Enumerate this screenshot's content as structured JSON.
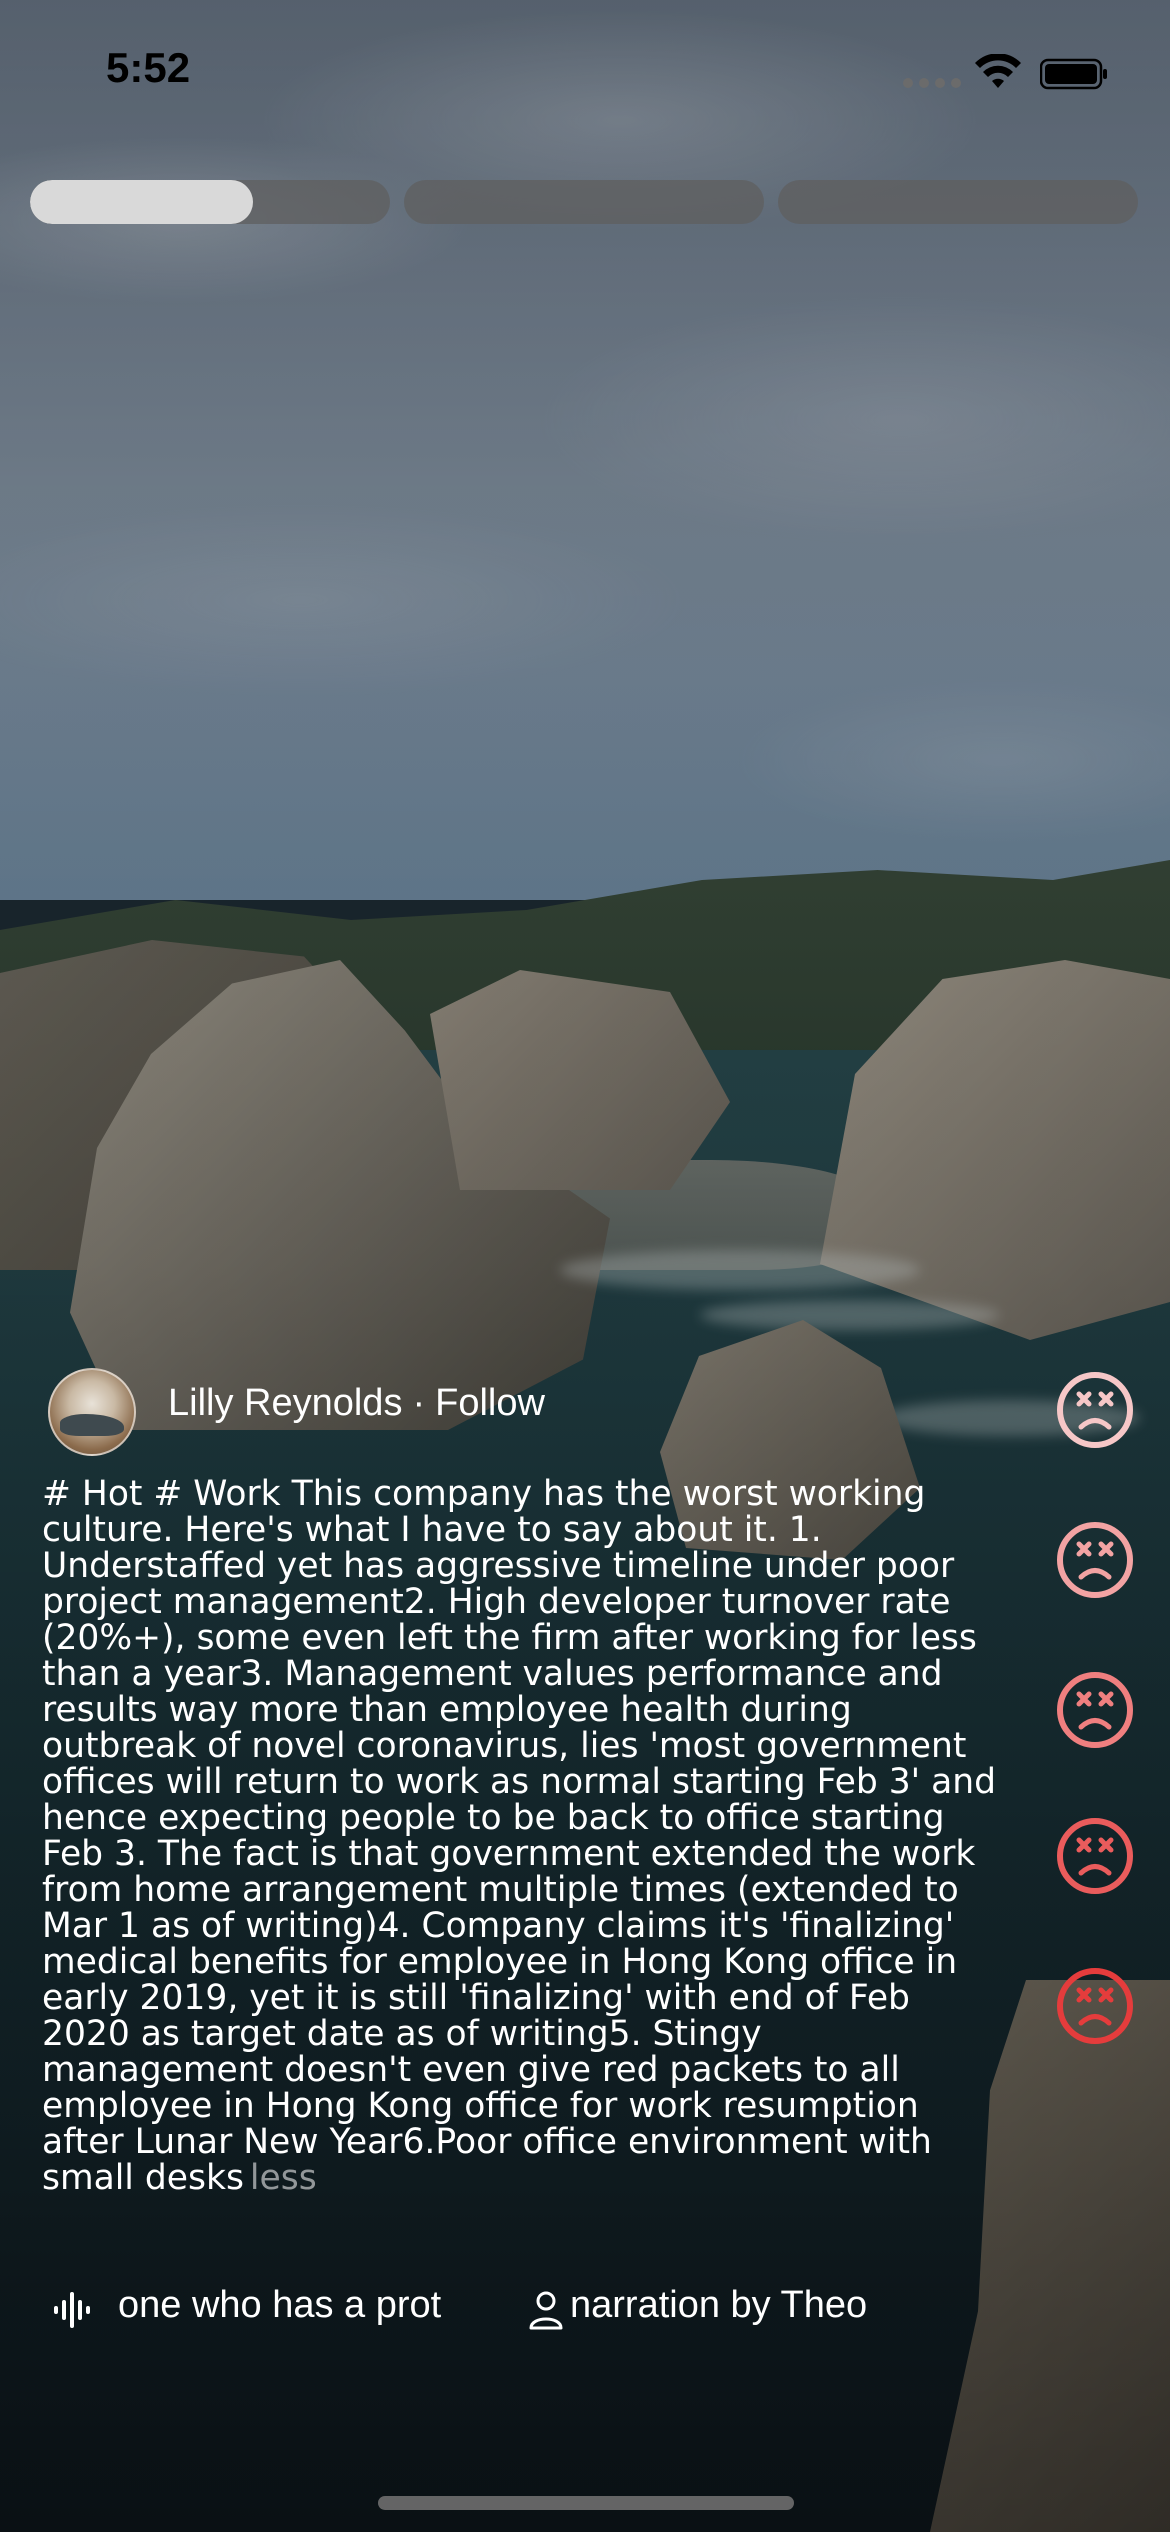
{
  "status_bar": {
    "time": "5:52"
  },
  "story_progress": [
    {
      "progress": 0.62
    },
    {
      "progress": 0.0
    },
    {
      "progress": 0.0
    }
  ],
  "author": {
    "name": "Lilly Reynolds",
    "separator": "·",
    "follow_label": "Follow"
  },
  "post": {
    "text": "# Hot # Work This company has the worst working culture. Here's what I have to say about it. 1. Understaffed yet has aggressive timeline under poor project management2. High developer turnover rate (20%+), some even left the firm after working for less than a year3. Management values performance and results way more than employee health during outbreak of novel coronavirus, lies 'most government offices will return to work as normal starting Feb 3' and hence expecting people to be back to office starting Feb 3. The fact is that government extended the work from home arrangement multiple times (extended to Mar 1 as of writing)4. Company claims it's 'finalizing' medical benefits for employee in Hong Kong office in early 2019, yet it is still 'finalizing' with end of Feb 2020 as target date as of writing5. Stingy management doesn't even give red packets to all employee in Hong Kong office for work resumption after Lunar New Year6.Poor office environment with small desks",
    "less_label": "less"
  },
  "reactions": [
    {
      "icon": "dizzy-face-icon",
      "color": "#f6c7c7"
    },
    {
      "icon": "dizzy-face-icon",
      "color": "#f3a3a3"
    },
    {
      "icon": "dizzy-face-icon",
      "color": "#ef7f7f"
    },
    {
      "icon": "dizzy-face-icon",
      "color": "#ea5c5c"
    },
    {
      "icon": "dizzy-face-icon",
      "color": "#e53c3c"
    }
  ],
  "audio": {
    "track_text": "one who has a prot",
    "narration": "narration by Theo"
  }
}
